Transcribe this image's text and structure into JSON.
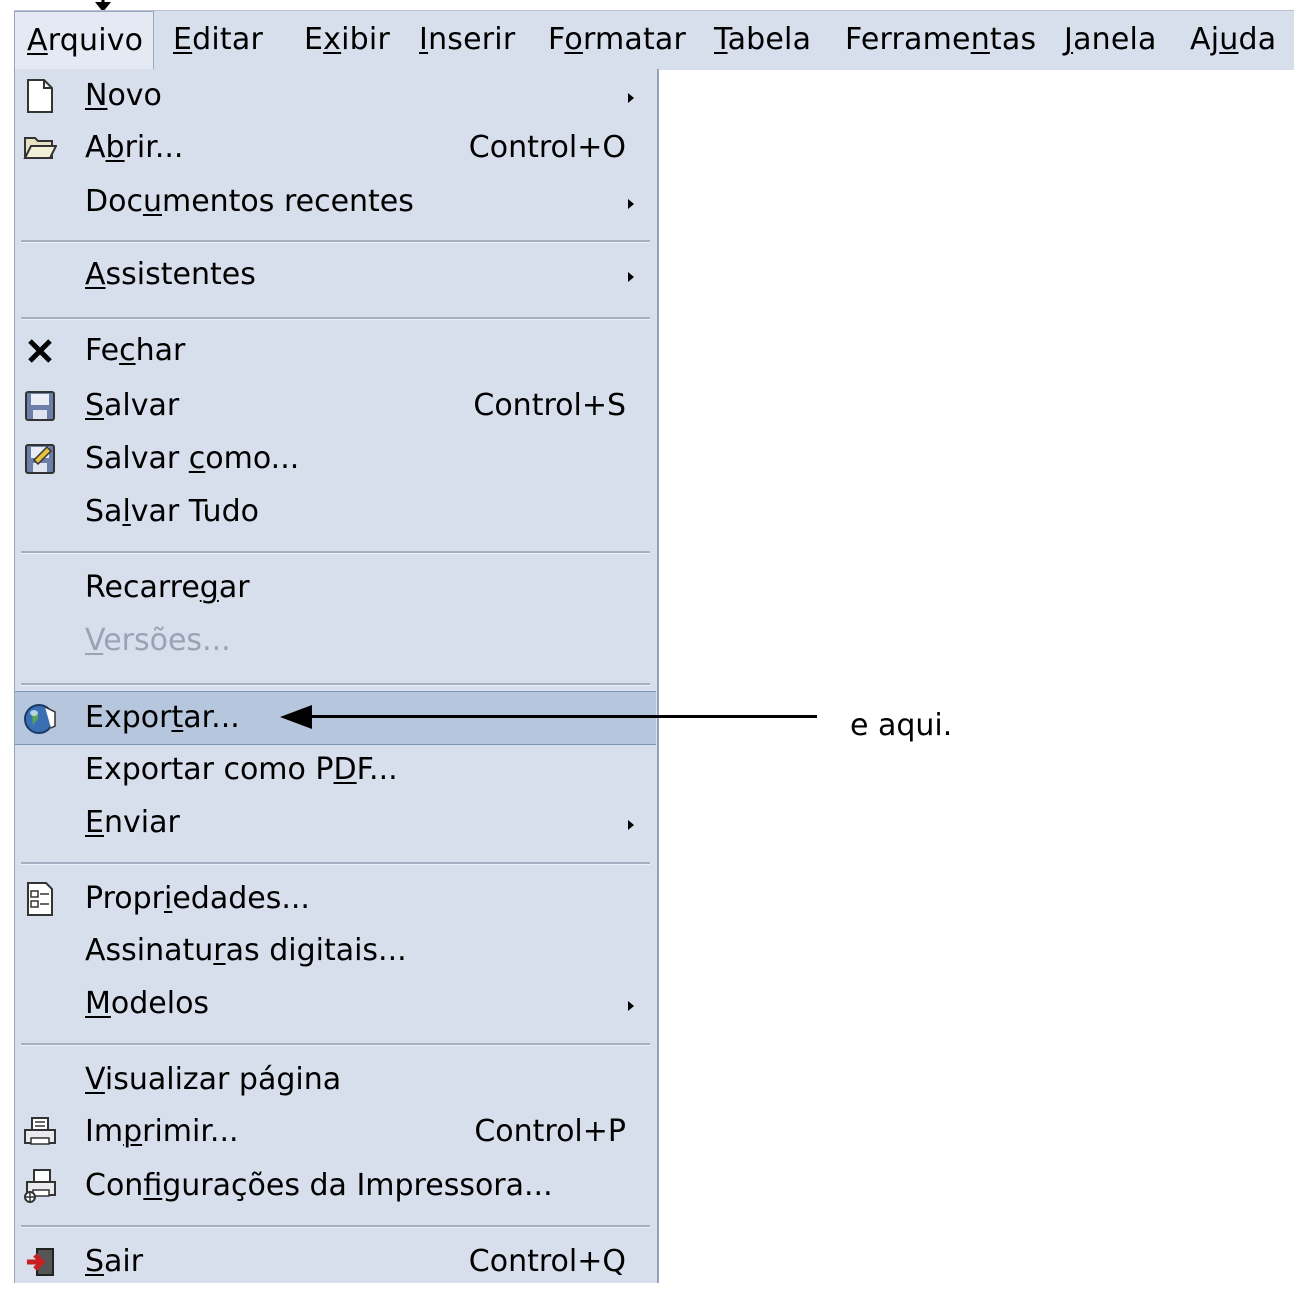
{
  "menubar": [
    {
      "pre": "",
      "u": "A",
      "post": "rquivo",
      "active": true
    },
    {
      "pre": "",
      "u": "E",
      "post": "ditar"
    },
    {
      "pre": "E",
      "u": "x",
      "post": "ibir"
    },
    {
      "pre": "",
      "u": "I",
      "post": "nserir"
    },
    {
      "pre": "F",
      "u": "o",
      "post": "rmatar"
    },
    {
      "pre": "",
      "u": "T",
      "post": "abela"
    },
    {
      "pre": "Ferrame",
      "u": "n",
      "post": "tas"
    },
    {
      "pre": "",
      "u": "J",
      "post": "anela"
    },
    {
      "pre": "Aj",
      "u": "u",
      "post": "da"
    }
  ],
  "menu": {
    "items": [
      {
        "icon": "new-document-icon",
        "pre": "",
        "u": "N",
        "post": "ovo",
        "submenu": true
      },
      {
        "icon": "open-folder-icon",
        "pre": "A",
        "u": "b",
        "post": "rir...",
        "shortcut": "Control+O"
      },
      {
        "icon": "",
        "pre": "Doc",
        "u": "u",
        "post": "mentos recentes",
        "submenu": true
      },
      {
        "icon": "",
        "pre": "",
        "u": "A",
        "post": "ssistentes",
        "submenu": true
      },
      {
        "icon": "close-icon",
        "pre": "Fe",
        "u": "c",
        "post": "har"
      },
      {
        "icon": "save-icon",
        "pre": "",
        "u": "S",
        "post": "alvar",
        "shortcut": "Control+S"
      },
      {
        "icon": "save-as-icon",
        "pre": "Salvar ",
        "u": "c",
        "post": "omo..."
      },
      {
        "icon": "",
        "pre": "Sa",
        "u": "l",
        "post": "var Tudo"
      },
      {
        "icon": "",
        "pre": "Recarre",
        "u": "g",
        "post": "ar"
      },
      {
        "icon": "",
        "pre": "",
        "u": "V",
        "post": "ersões...",
        "disabled": true
      },
      {
        "icon": "export-globe-icon",
        "pre": "Expor",
        "u": "t",
        "post": "ar...",
        "highlight": true
      },
      {
        "icon": "",
        "pre": "Exportar como P",
        "u": "D",
        "post": "F..."
      },
      {
        "icon": "",
        "pre": "",
        "u": "E",
        "post": "nviar",
        "submenu": true
      },
      {
        "icon": "properties-icon",
        "pre": "Propr",
        "u": "i",
        "post": "edades..."
      },
      {
        "icon": "",
        "pre": "Assinatu",
        "u": "r",
        "post": "as digitais..."
      },
      {
        "icon": "",
        "pre": "",
        "u": "M",
        "post": "odelos",
        "submenu": true
      },
      {
        "icon": "",
        "pre": "",
        "u": "V",
        "post": "isualizar página"
      },
      {
        "icon": "printer-icon",
        "pre": "Im",
        "u": "p",
        "post": "rimir...",
        "shortcut": "Control+P"
      },
      {
        "icon": "printer-settings-icon",
        "pre": "Con",
        "u": "f",
        "post": "igurações da Impressora..."
      },
      {
        "icon": "exit-icon",
        "pre": "",
        "u": "S",
        "post": "air",
        "shortcut": "Control+Q"
      }
    ]
  },
  "annotation": {
    "text": "e aqui."
  },
  "colors": {
    "menu_bg": "#d7deec",
    "highlight": "#b6c6dd",
    "disabled_text": "#9aa3b6"
  }
}
